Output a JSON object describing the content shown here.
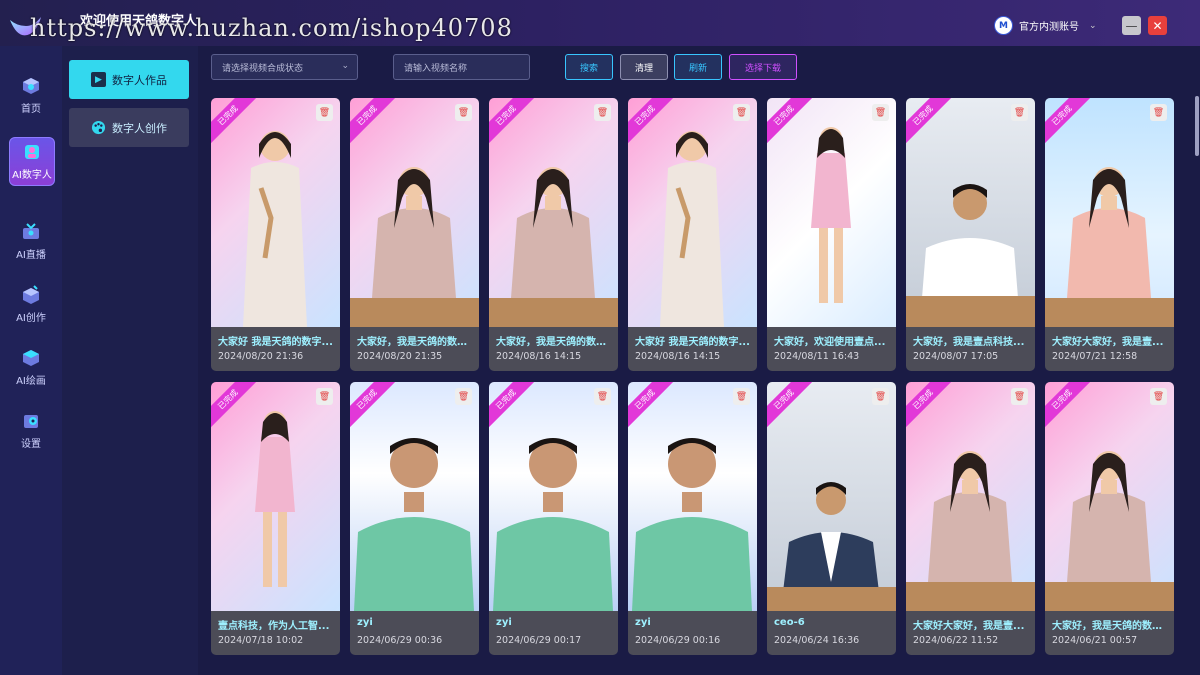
{
  "app": {
    "title": "欢迎使用天鸽数字人",
    "watermark": "https://www.huzhan.com/ishop40708",
    "account": {
      "avatar_text": "M",
      "name": "官方内测账号"
    },
    "window": {
      "minimize": "—",
      "close": "✕"
    }
  },
  "rail": [
    {
      "label": "首页",
      "icon": "home-icon",
      "active": false
    },
    {
      "label": "AI数字人",
      "icon": "digital-human-icon",
      "active": true
    },
    {
      "label": "AI直播",
      "icon": "live-icon",
      "active": false
    },
    {
      "label": "AI创作",
      "icon": "create-icon",
      "active": false
    },
    {
      "label": "AI绘画",
      "icon": "paint-icon",
      "active": false
    },
    {
      "label": "设置",
      "icon": "settings-icon",
      "active": false
    }
  ],
  "subnav": {
    "works": "数字人作品",
    "create": "数字人创作"
  },
  "filters": {
    "status_placeholder": "请选择视频合成状态",
    "name_placeholder": "请输入视频名称",
    "search": "搜索",
    "clear": "清理",
    "refresh": "刷新",
    "batch_download": "选择下载"
  },
  "badge_text": "已完成",
  "colors": {
    "accent_cyan": "#33d8ee",
    "badge_pink": "#e238d8",
    "delete_red": "#e34545"
  },
  "cards": [
    {
      "title": "大家好 我是天鸽的数字...",
      "date": "2024/08/20 21:36",
      "bg": "pink",
      "person": "qipao"
    },
    {
      "title": "大家好，我是天鸽的数字...",
      "date": "2024/08/20 21:35",
      "bg": "pink",
      "person": "woman-desk"
    },
    {
      "title": "大家好，我是天鸽的数字...",
      "date": "2024/08/16 14:15",
      "bg": "pink",
      "person": "woman-desk"
    },
    {
      "title": "大家好 我是天鸽的数字...",
      "date": "2024/08/16 14:15",
      "bg": "pink",
      "person": "qipao"
    },
    {
      "title": "大家好，欢迎使用壹点...",
      "date": "2024/08/11 16:43",
      "bg": "light",
      "person": "woman-standing"
    },
    {
      "title": "大家好，我是壹点科技...",
      "date": "2024/08/07 17:05",
      "bg": "gray",
      "person": "man-desk"
    },
    {
      "title": "大家好大家好，我是壹...",
      "date": "2024/07/21 12:58",
      "bg": "sky",
      "person": "woman-desk-2"
    },
    {
      "title": "壹点科技，作为人工智...",
      "date": "2024/07/18 10:02",
      "bg": "pink",
      "person": "woman-standing"
    },
    {
      "title": "zyi",
      "date": "2024/06/29 00:36",
      "bg": "blue",
      "person": "older-man"
    },
    {
      "title": "zyi",
      "date": "2024/06/29 00:17",
      "bg": "blue",
      "person": "older-man"
    },
    {
      "title": "zyi",
      "date": "2024/06/29 00:16",
      "bg": "blue",
      "person": "older-man"
    },
    {
      "title": "ceo-6",
      "date": "2024/06/24 16:36",
      "bg": "gray",
      "person": "man-suit"
    },
    {
      "title": "大家好大家好，我是壹...",
      "date": "2024/06/22 11:52",
      "bg": "pink",
      "person": "woman-desk"
    },
    {
      "title": "大家好，我是天鸽的数字...",
      "date": "2024/06/21 00:57",
      "bg": "pink",
      "person": "woman-desk"
    }
  ]
}
